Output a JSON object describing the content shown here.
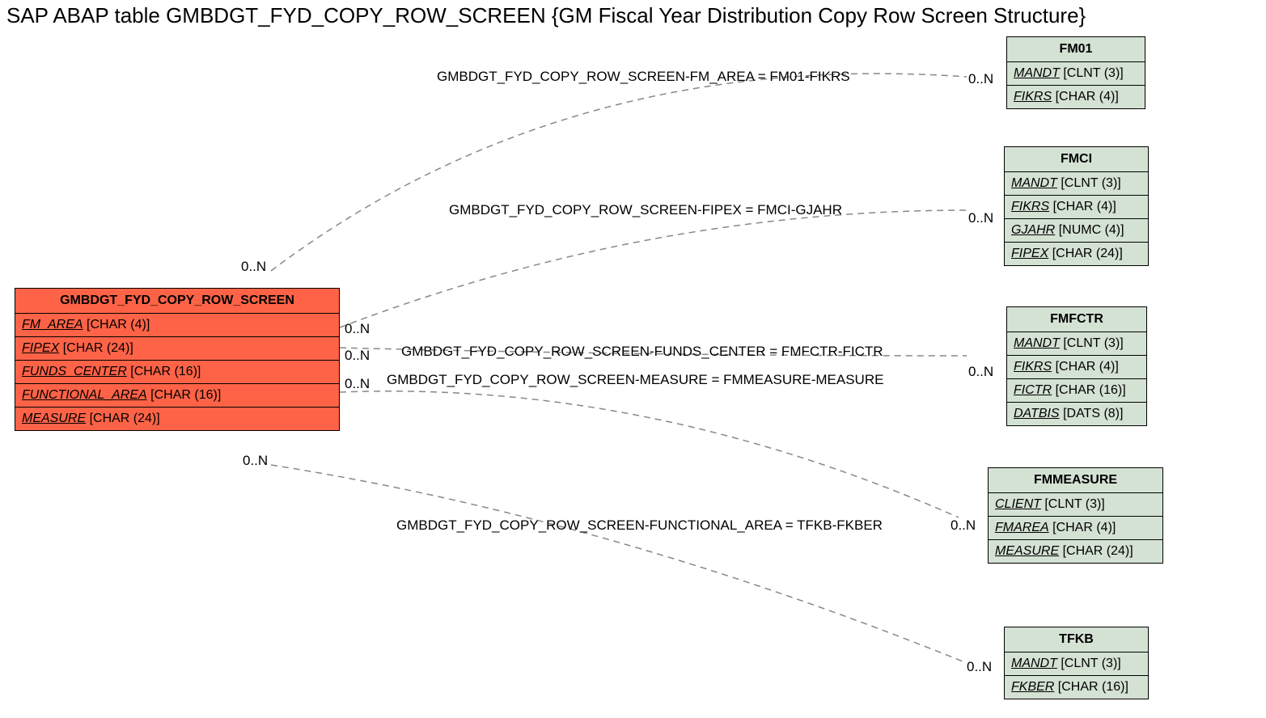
{
  "title": "SAP ABAP table GMBDGT_FYD_COPY_ROW_SCREEN {GM Fiscal Year Distribution Copy Row Screen Structure}",
  "main": {
    "name": "GMBDGT_FYD_COPY_ROW_SCREEN",
    "fields": [
      {
        "name": "FM_AREA",
        "type": "[CHAR (4)]"
      },
      {
        "name": "FIPEX",
        "type": "[CHAR (24)]"
      },
      {
        "name": "FUNDS_CENTER",
        "type": "[CHAR (16)]"
      },
      {
        "name": "FUNCTIONAL_AREA",
        "type": "[CHAR (16)]"
      },
      {
        "name": "MEASURE",
        "type": "[CHAR (24)]"
      }
    ]
  },
  "refs": [
    {
      "name": "FM01",
      "fields": [
        {
          "name": "MANDT",
          "type": "[CLNT (3)]"
        },
        {
          "name": "FIKRS",
          "type": "[CHAR (4)]"
        }
      ]
    },
    {
      "name": "FMCI",
      "fields": [
        {
          "name": "MANDT",
          "type": "[CLNT (3)]"
        },
        {
          "name": "FIKRS",
          "type": "[CHAR (4)]"
        },
        {
          "name": "GJAHR",
          "type": "[NUMC (4)]"
        },
        {
          "name": "FIPEX",
          "type": "[CHAR (24)]"
        }
      ]
    },
    {
      "name": "FMFCTR",
      "fields": [
        {
          "name": "MANDT",
          "type": "[CLNT (3)]"
        },
        {
          "name": "FIKRS",
          "type": "[CHAR (4)]"
        },
        {
          "name": "FICTR",
          "type": "[CHAR (16)]"
        },
        {
          "name": "DATBIS",
          "type": "[DATS (8)]"
        }
      ]
    },
    {
      "name": "FMMEASURE",
      "fields": [
        {
          "name": "CLIENT",
          "type": "[CLNT (3)]"
        },
        {
          "name": "FMAREA",
          "type": "[CHAR (4)]"
        },
        {
          "name": "MEASURE",
          "type": "[CHAR (24)]"
        }
      ]
    },
    {
      "name": "TFKB",
      "fields": [
        {
          "name": "MANDT",
          "type": "[CLNT (3)]"
        },
        {
          "name": "FKBER",
          "type": "[CHAR (16)]"
        }
      ]
    }
  ],
  "rels": [
    {
      "label": "GMBDGT_FYD_COPY_ROW_SCREEN-FM_AREA = FM01-FIKRS"
    },
    {
      "label": "GMBDGT_FYD_COPY_ROW_SCREEN-FIPEX = FMCI-GJAHR"
    },
    {
      "label": "GMBDGT_FYD_COPY_ROW_SCREEN-FUNDS_CENTER = FMFCTR-FICTR"
    },
    {
      "label": "GMBDGT_FYD_COPY_ROW_SCREEN-MEASURE = FMMEASURE-MEASURE"
    },
    {
      "label": "GMBDGT_FYD_COPY_ROW_SCREEN-FUNCTIONAL_AREA = TFKB-FKBER"
    }
  ],
  "card": "0..N"
}
